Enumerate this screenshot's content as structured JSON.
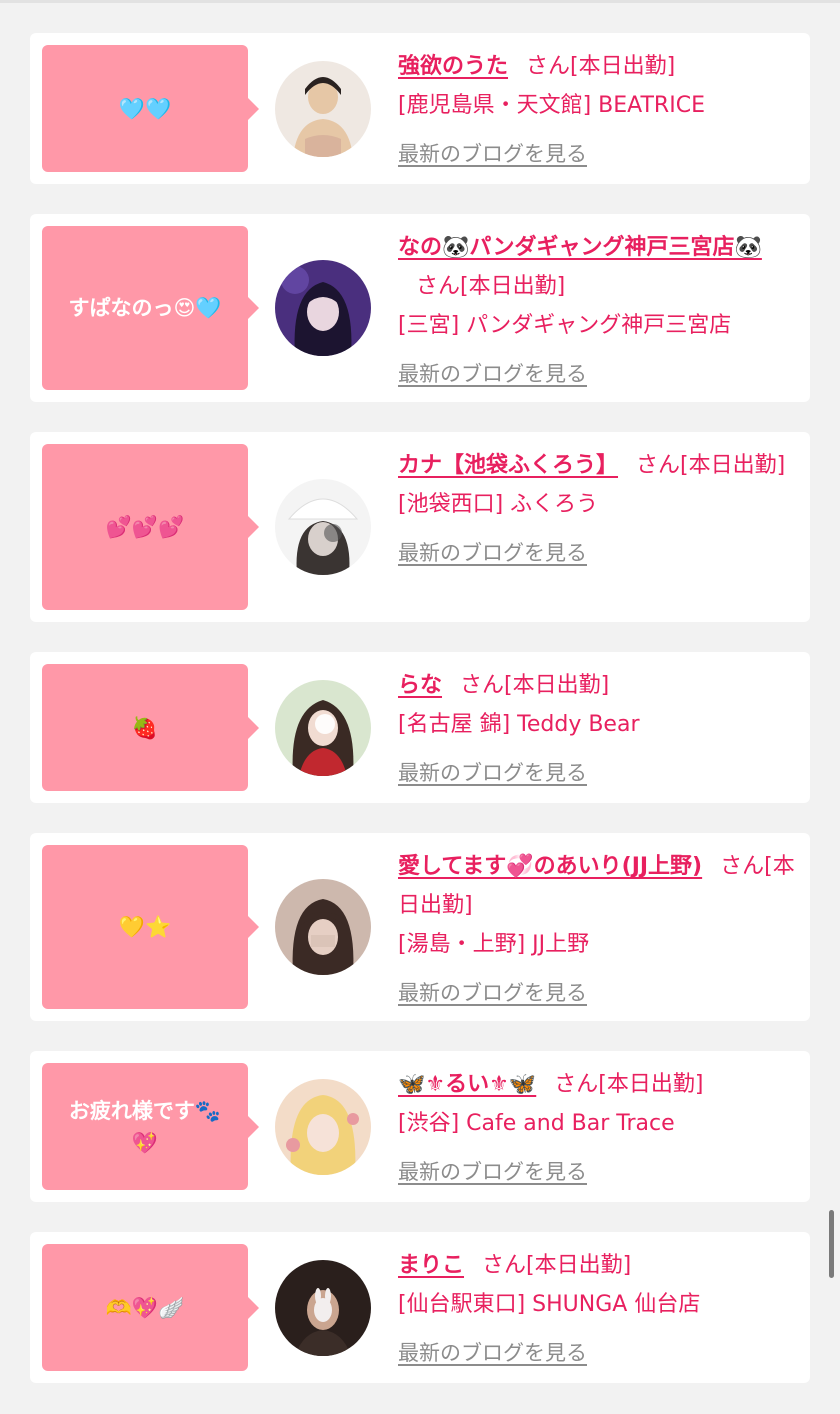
{
  "profiles": [
    {
      "message": "🩵🩵",
      "name": "強欲のうた",
      "status": "さん[本日出勤]",
      "shop": "[鹿児島県・天文館] BEATRICE",
      "blog_link": "最新のブログを見る",
      "avatar_icon": "avatar-photo",
      "avatar_colors": [
        "#efe8e2",
        "#d9b39c",
        "#e6c7a6"
      ]
    },
    {
      "message": "すぱなのっ😍🩵",
      "name": "なの🐼パンダギャング神戸三宮店🐼",
      "status": "さん[本日出勤]",
      "shop": "[三宮] パンダギャング神戸三宮店",
      "blog_link": "最新のブログを見る",
      "avatar_icon": "avatar-photo",
      "avatar_colors": [
        "#4a2f7e",
        "#1c1430",
        "#c3a2d8"
      ]
    },
    {
      "message": "💕💕💕",
      "name": "カナ【池袋ふくろう】",
      "status": "さん[本日出勤]",
      "shop": "[池袋西口] ふくろう",
      "blog_link": "最新のブログを見る",
      "avatar_icon": "avatar-photo",
      "avatar_colors": [
        "#f4f4f4",
        "#d8d0cc",
        "#3a3432"
      ]
    },
    {
      "message": "🍓",
      "name": "らな",
      "status": "さん[本日出勤]",
      "shop": "[名古屋 錦] Teddy Bear",
      "blog_link": "最新のブログを見る",
      "avatar_icon": "avatar-photo",
      "avatar_colors": [
        "#d9e6cf",
        "#c1282f",
        "#3a2a24"
      ]
    },
    {
      "message": "💛⭐",
      "name": "愛してます💞のあいり(JJ上野)",
      "status": "さん[本日出勤]",
      "shop": "[湯島・上野] JJ上野",
      "blog_link": "最新のブログを見る",
      "avatar_icon": "avatar-photo",
      "avatar_colors": [
        "#cdb8ad",
        "#3b2a25",
        "#e6cfc4"
      ]
    },
    {
      "message": "お疲れ様です🐾💖",
      "name": "🦋⚜るい⚜🦋",
      "status": "さん[本日出勤]",
      "shop": "[渋谷] Cafe and Bar Trace",
      "blog_link": "最新のブログを見る",
      "avatar_icon": "avatar-photo",
      "avatar_colors": [
        "#f3dcc8",
        "#f2d27a",
        "#e89aa0"
      ]
    },
    {
      "message": "🫶💖🪽",
      "name": "まりこ",
      "status": "さん[本日出勤]",
      "shop": "[仙台駅東口] SHUNGA 仙台店",
      "blog_link": "最新のブログを見る",
      "avatar_icon": "avatar-photo",
      "avatar_colors": [
        "#2a1f1c",
        "#caa590",
        "#f2eeee"
      ]
    }
  ]
}
